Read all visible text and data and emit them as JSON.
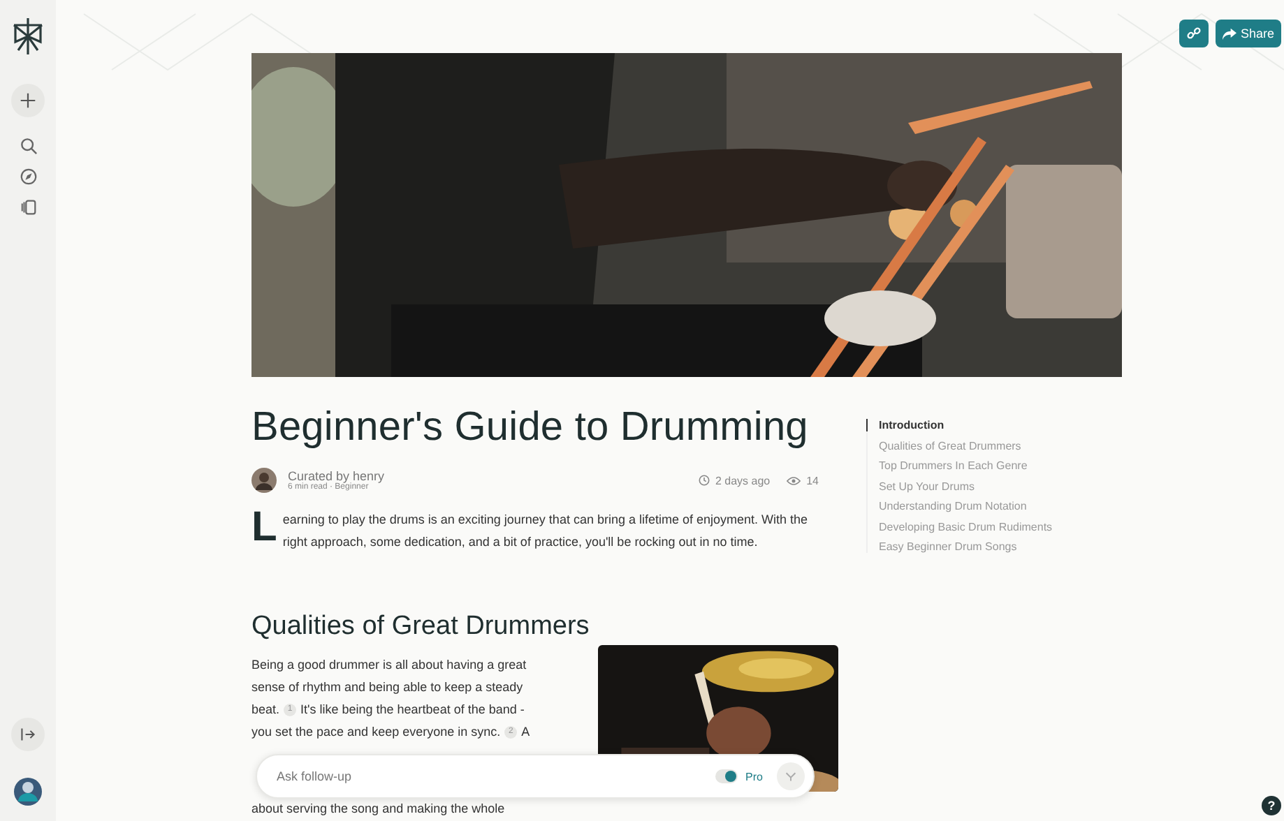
{
  "topbar": {
    "share": "Share"
  },
  "article": {
    "title": "Beginner's Guide to Drumming",
    "author": "Curated by henry",
    "meta": "6 min read · Beginner",
    "age": "2 days ago",
    "views": "14",
    "dropcap": "L",
    "intro": "earning to play the drums is an exciting journey that can bring a lifetime of enjoyment. With the right approach, some dedication, and a bit of practice, you'll be rocking out in no time."
  },
  "toc": [
    {
      "label": "Introduction",
      "selected": true
    },
    {
      "label": "Qualities of Great Drummers",
      "selected": false
    },
    {
      "label": "Top Drummers In Each Genre",
      "selected": false
    },
    {
      "label": "Set Up Your Drums",
      "selected": false
    },
    {
      "label": "Understanding Drum Notation",
      "selected": false
    },
    {
      "label": "Developing Basic Drum Rudiments",
      "selected": false
    },
    {
      "label": "Easy Beginner Drum Songs",
      "selected": false
    }
  ],
  "section": {
    "heading": "Qualities of Great Drummers",
    "lines": [
      {
        "before": "Being a good drummer is all about having a great"
      },
      {
        "before": "sense of rhythm and being able to keep a steady"
      },
      {
        "before": "beat.",
        "cite": "1",
        "after": "It's like being the heartbeat of the band -"
      },
      {
        "before": "you set the pace and keep everyone in sync.",
        "cite": "2",
        "after": "A"
      },
      {
        "before": "about serving the song and making the whole"
      }
    ]
  },
  "followup": {
    "placeholder": "Ask follow-up",
    "pro_label": "Pro",
    "pro_on": true
  },
  "help": "?"
}
